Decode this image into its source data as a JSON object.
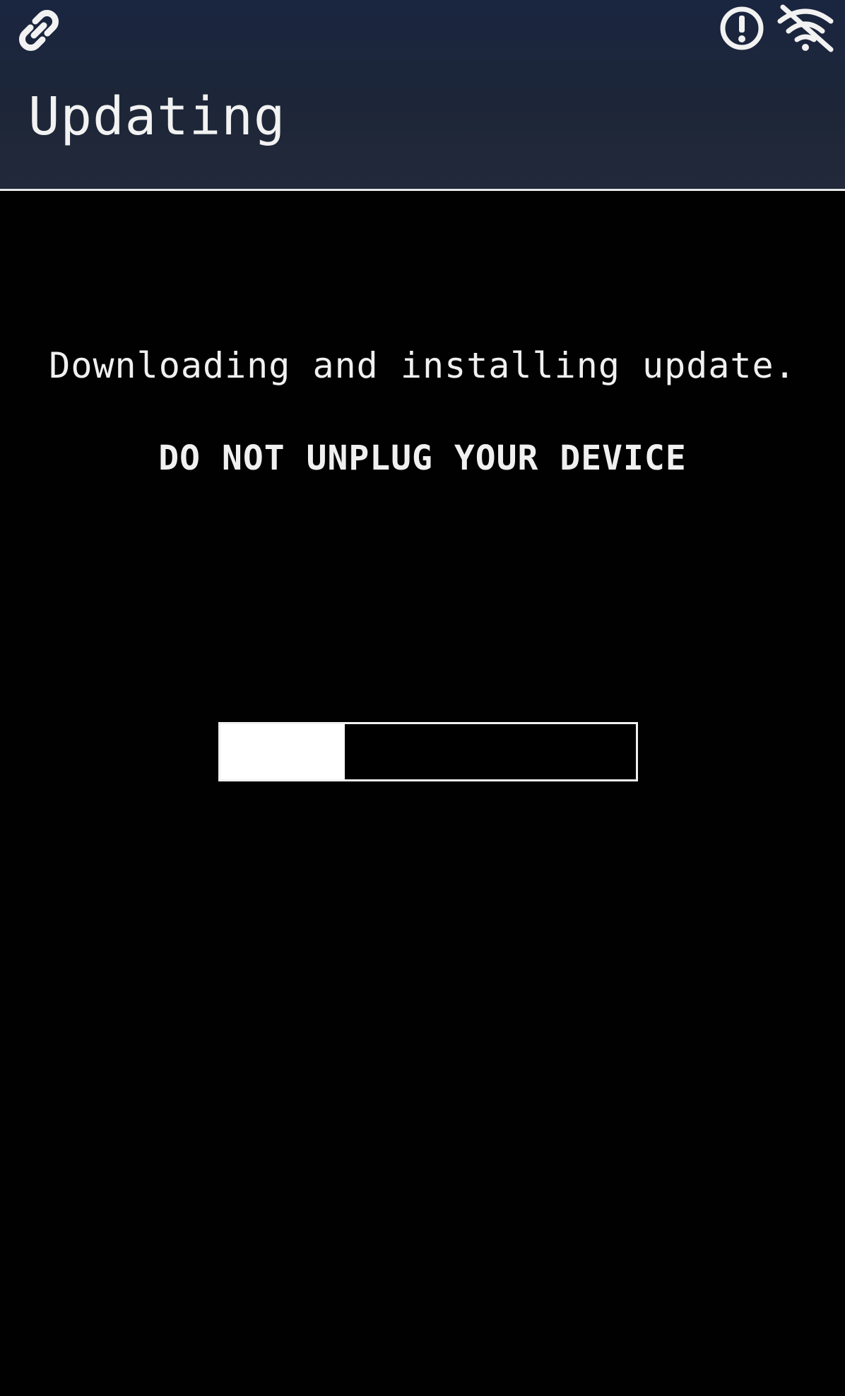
{
  "screen": {
    "title": "Updating",
    "status_icons": [
      "link-icon",
      "alert-circle-icon",
      "wifi-off-icon"
    ]
  },
  "message": {
    "primary": "Downloading and installing update.",
    "warning": "DO NOT UNPLUG YOUR DEVICE"
  },
  "progress": {
    "fraction": 0.3
  },
  "colors": {
    "header_background": "#1d2638",
    "background": "#010102",
    "text": "#f0f0f0",
    "progress_fill": "#ffffff"
  }
}
